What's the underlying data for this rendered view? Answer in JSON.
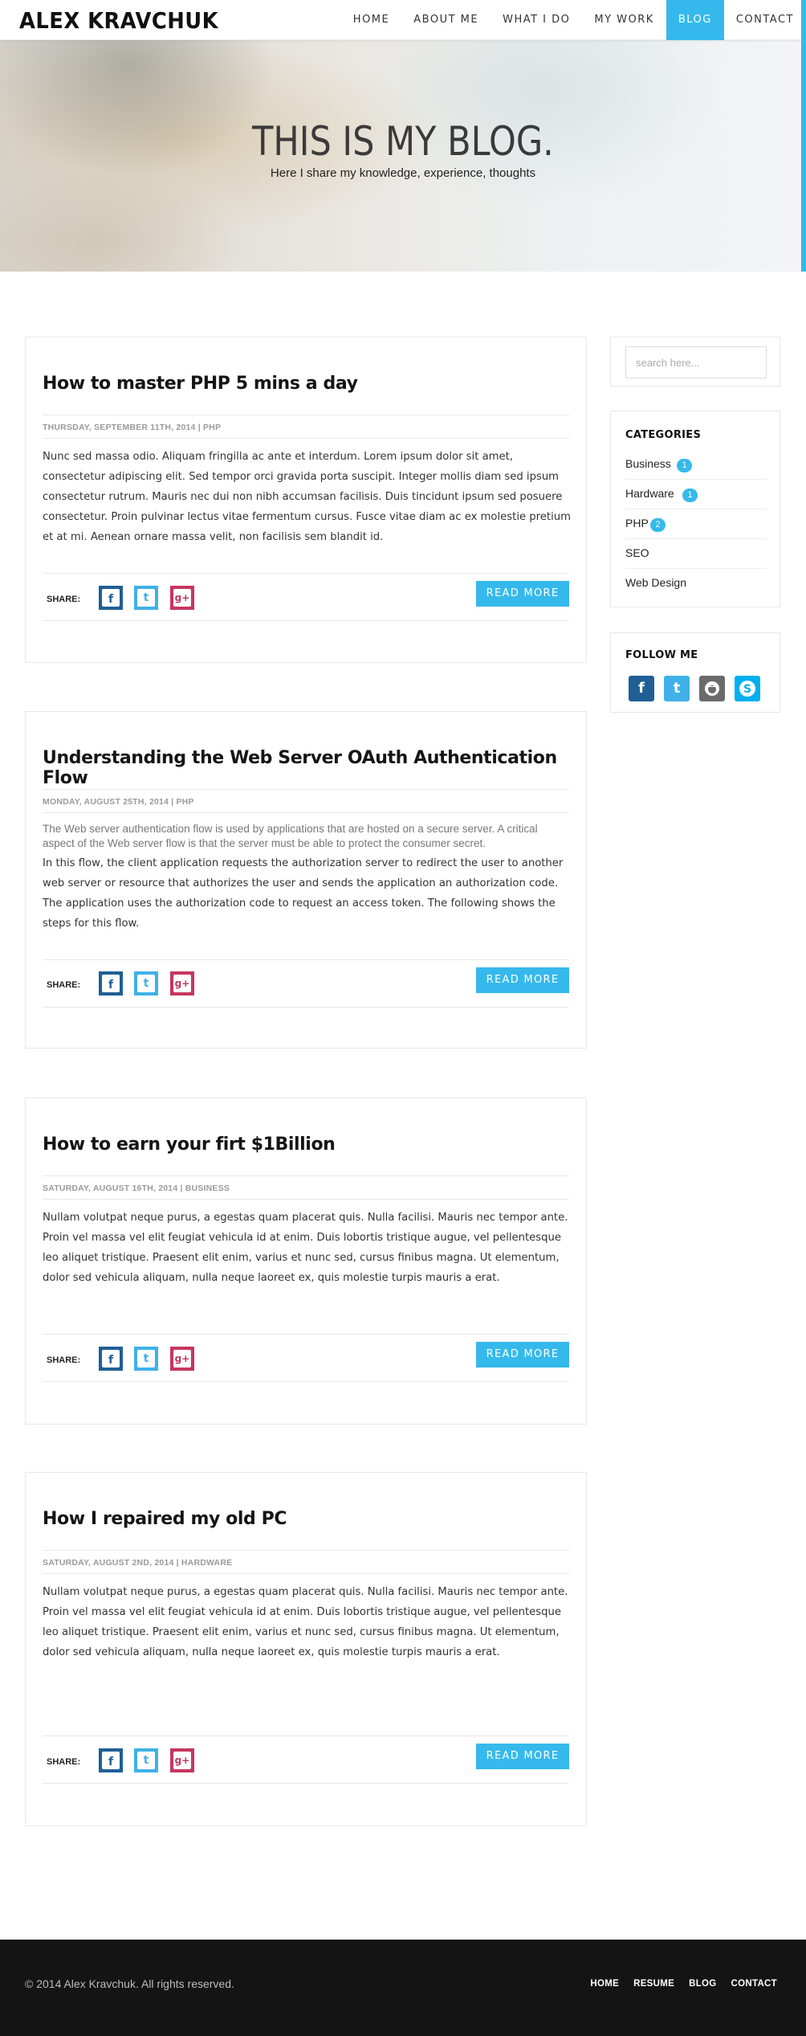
{
  "header": {
    "logo": "ALEX KRAVCHUK",
    "nav": [
      "HOME",
      "ABOUT ME",
      "WHAT I DO",
      "MY WORK",
      "BLOG",
      "CONTACT"
    ],
    "active_nav": "BLOG"
  },
  "hero": {
    "title": "THIS IS MY BLOG.",
    "subtitle": "Here I share my knowledge, experience, thoughts"
  },
  "posts": [
    {
      "title": "How to master PHP 5 mins a day",
      "meta": "THURSDAY, SEPTEMBER 11TH, 2014 | PHP",
      "lead": "",
      "excerpt": "Nunc sed massa odio. Aliquam fringilla ac ante et interdum. Lorem ipsum dolor sit amet, consectetur adipiscing elit. Sed tempor orci gravida porta suscipit. Integer mollis diam sed ipsum consectetur rutrum. Mauris nec dui non nibh accumsan facilisis. Duis tincidunt ipsum sed posuere consectetur. Proin pulvinar lectus vitae fermentum cursus. Fusce vitae diam ac ex molestie pretium et at mi. Aenean ornare massa velit, non facilisis sem blandit id.",
      "share_label": "SHARE:",
      "read_more": "READ MORE"
    },
    {
      "title": "Understanding the Web Server OAuth Authentication Flow",
      "meta": "MONDAY, AUGUST 25TH, 2014 | PHP",
      "lead": "The Web server authentication flow is used by applications that are hosted on a secure server. A critical aspect of the Web server flow is that the server must be able to protect the consumer secret.",
      "excerpt": "In this flow, the client application requests the authorization server to redirect the user to another web server or resource that authorizes the user and sends the application an authorization code. The application uses the authorization code to request an access token. The following shows the steps for this flow.",
      "share_label": "SHARE:",
      "read_more": "READ MORE"
    },
    {
      "title": "How to earn your firt $1Billion",
      "meta": "SATURDAY, AUGUST 16TH, 2014 | BUSINESS",
      "lead": "",
      "excerpt": "Nullam volutpat neque purus, a egestas quam placerat quis. Nulla facilisi. Mauris nec tempor ante. Proin vel massa vel elit feugiat vehicula id at enim. Duis lobortis tristique augue, vel pellentesque leo aliquet tristique. Praesent elit enim, varius et nunc sed, cursus finibus magna. Ut elementum, dolor sed vehicula aliquam, nulla neque laoreet ex, quis molestie turpis mauris a erat.",
      "share_label": "SHARE:",
      "read_more": "READ MORE"
    },
    {
      "title": "How I repaired my old PC",
      "meta": "SATURDAY, AUGUST 2ND, 2014 | HARDWARE",
      "lead": "",
      "excerpt": "Nullam volutpat neque purus, a egestas quam placerat quis. Nulla facilisi. Mauris nec tempor ante. Proin vel massa vel elit feugiat vehicula id at enim. Duis lobortis tristique augue, vel pellentesque leo aliquet tristique. Praesent elit enim, varius et nunc sed, cursus finibus magna. Ut elementum, dolor sed vehicula aliquam, nulla neque laoreet ex, quis molestie turpis mauris a erat.",
      "share_label": "SHARE:",
      "read_more": "READ MORE"
    }
  ],
  "share_icons": [
    "facebook-icon",
    "twitter-icon",
    "google-plus-icon"
  ],
  "sidebar": {
    "search_placeholder": "search here...",
    "categories_title": "CATEGORIES",
    "categories": [
      {
        "name": "Business",
        "count": "1"
      },
      {
        "name": "Hardware",
        "count": "1"
      },
      {
        "name": "PHP",
        "count": "2"
      },
      {
        "name": "SEO",
        "count": ""
      },
      {
        "name": "Web Design",
        "count": ""
      }
    ],
    "follow_title": "FOLLOW ME",
    "follow_icons": [
      "facebook-icon",
      "twitter-icon",
      "github-icon",
      "skype-icon"
    ]
  },
  "footer": {
    "copyright": "© 2014 Alex Kravchuk. All rights reserved.",
    "links": [
      "HOME",
      "RESUME",
      "BLOG",
      "CONTACT"
    ]
  },
  "colors": {
    "accent": "#35b9ec",
    "facebook": "#1f5f96",
    "twitter": "#3fb1e8",
    "google_plus": "#c63660",
    "github": "#6b6b6b",
    "skype": "#00aff0",
    "footer_bg": "#141414"
  }
}
